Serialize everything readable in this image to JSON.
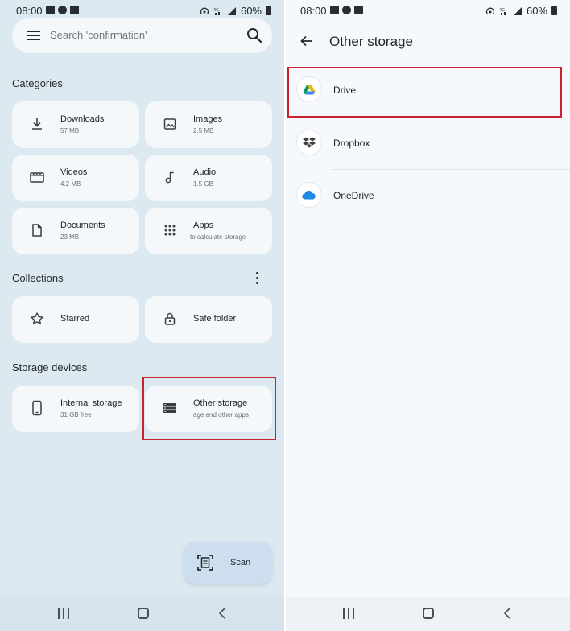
{
  "status": {
    "time": "08:00",
    "battery": "60%"
  },
  "left": {
    "search_placeholder": "Search 'confirmation'",
    "categories_title": "Categories",
    "categories": [
      {
        "name": "Downloads",
        "sub": "57 MB",
        "icon": "download-icon"
      },
      {
        "name": "Images",
        "sub": "2.5 MB",
        "icon": "image-icon"
      },
      {
        "name": "Videos",
        "sub": "4.2 MB",
        "icon": "video-icon"
      },
      {
        "name": "Audio",
        "sub": "1.5 GB",
        "icon": "music-note-icon"
      },
      {
        "name": "Documents",
        "sub": "23 MB",
        "icon": "document-icon"
      },
      {
        "name": "Apps",
        "sub": "to calculate storage",
        "icon": "apps-grid-icon"
      }
    ],
    "collections_title": "Collections",
    "collections": [
      {
        "name": "Starred",
        "icon": "star-icon"
      },
      {
        "name": "Safe folder",
        "icon": "lock-icon"
      }
    ],
    "storage_title": "Storage devices",
    "storage": [
      {
        "name": "Internal storage",
        "sub": "31 GB free",
        "icon": "phone-icon"
      },
      {
        "name": "Other storage",
        "sub": "age and other apps",
        "icon": "storage-list-icon"
      }
    ],
    "scan_label": "Scan"
  },
  "right": {
    "title": "Other storage",
    "items": [
      {
        "name": "Drive",
        "icon": "google-drive-icon"
      },
      {
        "name": "Dropbox",
        "icon": "dropbox-icon"
      },
      {
        "name": "OneDrive",
        "icon": "onedrive-icon"
      }
    ]
  },
  "colors": {
    "left_bg": "#dde9f1",
    "tile_bg": "#f4f8fb",
    "right_bg": "#f5f8fc",
    "highlight": "#c8242f"
  }
}
